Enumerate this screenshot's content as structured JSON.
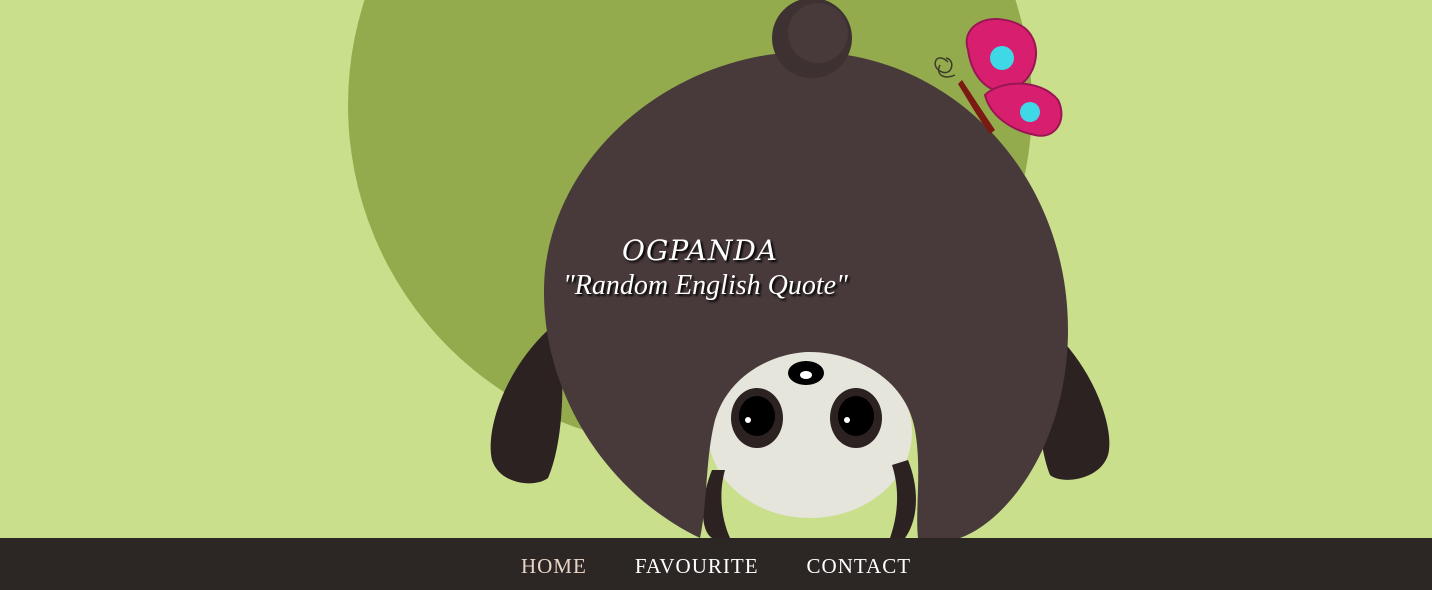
{
  "hero": {
    "title": "OGPANDA",
    "subtitle": "\"Random English Quote\""
  },
  "nav": {
    "items": [
      {
        "label": "HOME",
        "active": true
      },
      {
        "label": "FAVOURITE",
        "active": false
      },
      {
        "label": "CONTACT",
        "active": false
      }
    ]
  },
  "colors": {
    "background": "#c9df8c",
    "circle": "#94ab4d",
    "panda_body": "#483a3b",
    "panda_dark": "#2c2222",
    "panda_face": "#e6e5db",
    "butterfly_wing": "#d81f6f",
    "butterfly_spot": "#3fd8e7",
    "navbar": "#2c2624"
  }
}
